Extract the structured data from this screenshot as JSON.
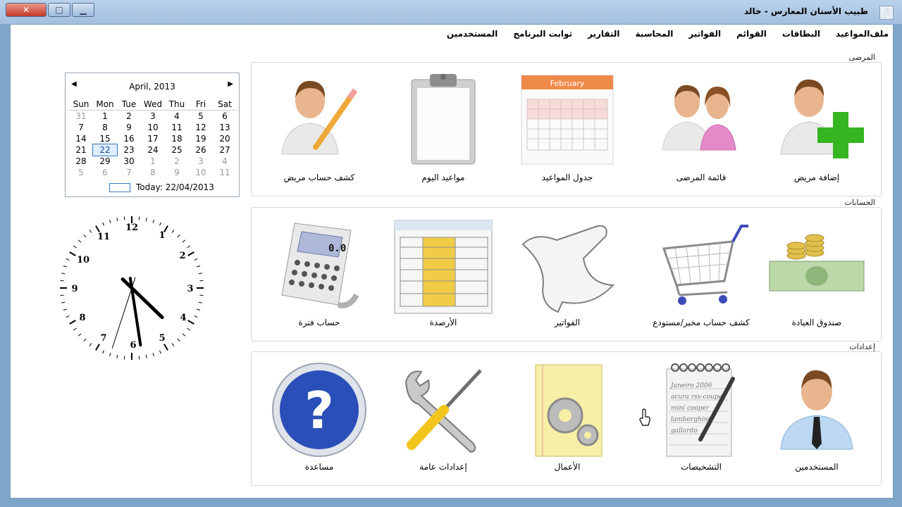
{
  "window": {
    "title": "طبيب الأسنان المعارس - خالد",
    "controls": {
      "close": "✕",
      "maximize": "□",
      "minimize": "▁"
    }
  },
  "menu": [
    "ملف",
    "المواعيد",
    "البطاقات",
    "القوائم",
    "الفواتير",
    "المحاسبة",
    "التقارير",
    "ثوابت البرنامج",
    "المستخدمين"
  ],
  "sections": {
    "patients": {
      "title": "المرضى",
      "items": [
        "إضافة مريض",
        "قائمة المرضى",
        "جدول المواعيد",
        "مواعيد اليوم",
        "كشف حساب مريض"
      ],
      "calendar_icon_month": "February"
    },
    "accounts": {
      "title": "الحسابات",
      "items": [
        "صندوق العيادة",
        "كشف حساب مخبر/مستودع",
        "الفواتير",
        "الأرصدة",
        "حساب فترة"
      ],
      "calculator_display": "0.0"
    },
    "settings": {
      "title": "إعدادات",
      "items": [
        "المستخدمين",
        "التشخيصات",
        "الأعمال",
        "إعدادات عامة",
        "مساعدة"
      ],
      "notepad_lines": [
        "Janeiro 2006",
        "acura rsx-coupe",
        "mini cooper",
        "lamborghini",
        "gallardo"
      ]
    }
  },
  "calendar": {
    "month_label": "April, 2013",
    "weekdays": [
      "Sun",
      "Mon",
      "Tue",
      "Wed",
      "Thu",
      "Fri",
      "Sat"
    ],
    "weeks": [
      [
        "31",
        "1",
        "2",
        "3",
        "4",
        "5",
        "6"
      ],
      [
        "7",
        "8",
        "9",
        "10",
        "11",
        "12",
        "13"
      ],
      [
        "14",
        "15",
        "16",
        "17",
        "18",
        "19",
        "20"
      ],
      [
        "21",
        "22",
        "23",
        "24",
        "25",
        "26",
        "27"
      ],
      [
        "28",
        "29",
        "30",
        "1",
        "2",
        "3",
        "4"
      ],
      [
        "5",
        "6",
        "7",
        "8",
        "9",
        "10",
        "11"
      ]
    ],
    "today_label": "Today: 22/04/2013",
    "selected_day": "22"
  },
  "clock": {
    "numbers": [
      "12",
      "1",
      "2",
      "3",
      "4",
      "5",
      "6",
      "7",
      "8",
      "9",
      "10",
      "11"
    ],
    "time": {
      "hour": 4,
      "minute": 28,
      "second": 33
    }
  },
  "colors": {
    "title_bar": "#a4c0df",
    "close_button": "#c4392a",
    "selection": "#3a7ac0",
    "plus_green": "#35b51f",
    "help_blue": "#2b4fb8"
  }
}
